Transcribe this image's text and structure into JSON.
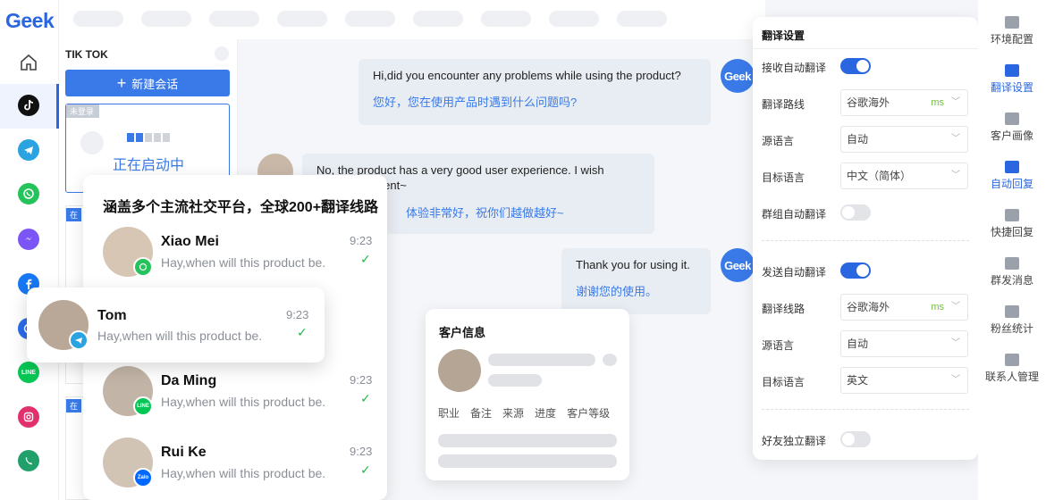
{
  "brand": "Geek",
  "rail_apps": [
    {
      "name": "home",
      "color": "#555555"
    },
    {
      "name": "tiktok",
      "color": "#000000"
    },
    {
      "name": "telegram",
      "color": "#2aa3e0"
    },
    {
      "name": "whatsapp",
      "color": "#25c35b"
    },
    {
      "name": "messenger",
      "color": "#7b55f5"
    },
    {
      "name": "facebook",
      "color": "#1877f2"
    },
    {
      "name": "signal",
      "color": "#2c6bed"
    },
    {
      "name": "line",
      "color": "#06c755"
    },
    {
      "name": "instagram",
      "color": "#e1306c"
    },
    {
      "name": "viber",
      "color": "#22a06b"
    }
  ],
  "sessions": {
    "title": "TIK TOK",
    "new_chat": "新建会话",
    "unlogged": "未登录",
    "starting": "正在启动中",
    "online_tag": "在"
  },
  "chat": {
    "messages": [
      {
        "src": "Hi,did you encounter any problems while using the product?",
        "tr": "您好，您在使用产品时遇到什么问题吗?"
      },
      {
        "src": "No, the product has a very good user experience. I wish",
        "src2": "ed improvement~",
        "tr": "体验非常好，祝你们越做越好~"
      },
      {
        "src": "Thank you for using it.",
        "tr": "谢谢您的使用。"
      }
    ],
    "geek_avatar": "Geek"
  },
  "contacts": {
    "title": "涵盖多个主流社交平台，全球200+翻译线路",
    "items": [
      {
        "name": "Xiao Mei",
        "msg": "Hay,when will this product be.",
        "time": "9:23",
        "badge": "whatsapp"
      },
      {
        "name": "Tom",
        "msg": "Hay,when will this product be.",
        "time": "9:23",
        "badge": "telegram"
      },
      {
        "name": "Da Ming",
        "msg": "Hay,when will this product be.",
        "time": "9:23",
        "badge": "line"
      },
      {
        "name": "Rui Ke",
        "msg": "Hay,when will this product be.",
        "time": "9:23",
        "badge": "zalo"
      }
    ],
    "badge_line": "LINE",
    "badge_zalo": "Zalo"
  },
  "customer_info": {
    "title": "客户信息",
    "fields": [
      "职业",
      "备注",
      "来源",
      "进度",
      "客户等级"
    ]
  },
  "settings": {
    "title": "翻译设置",
    "recv_auto": "接收自动翻译",
    "route1": "翻译路线",
    "route1_val": "谷歌海外",
    "ms1": "ms",
    "src1": "源语言",
    "src1_val": "自动",
    "tgt1": "目标语言",
    "tgt1_val": "中文（简体）",
    "group_auto": "群组自动翻译",
    "send_auto": "发送自动翻译",
    "route2": "翻译线路",
    "route2_val": "谷歌海外",
    "ms2": "ms",
    "src2": "源语言",
    "src2_val": "自动",
    "tgt2": "目标语言",
    "tgt2_val": "英文",
    "friend_indep": "好友独立翻译"
  },
  "right_rail": [
    {
      "label": "环境配置",
      "active": false
    },
    {
      "label": "翻译设置",
      "active": true
    },
    {
      "label": "客户画像",
      "active": false
    },
    {
      "label": "自动回复",
      "active": true
    },
    {
      "label": "快捷回复",
      "active": false
    },
    {
      "label": "群发消息",
      "active": false
    },
    {
      "label": "粉丝统计",
      "active": false
    },
    {
      "label": "联系人管理",
      "active": false
    }
  ],
  "colors": {
    "accent": "#2a66e0",
    "online_check": "#1fb94a"
  }
}
